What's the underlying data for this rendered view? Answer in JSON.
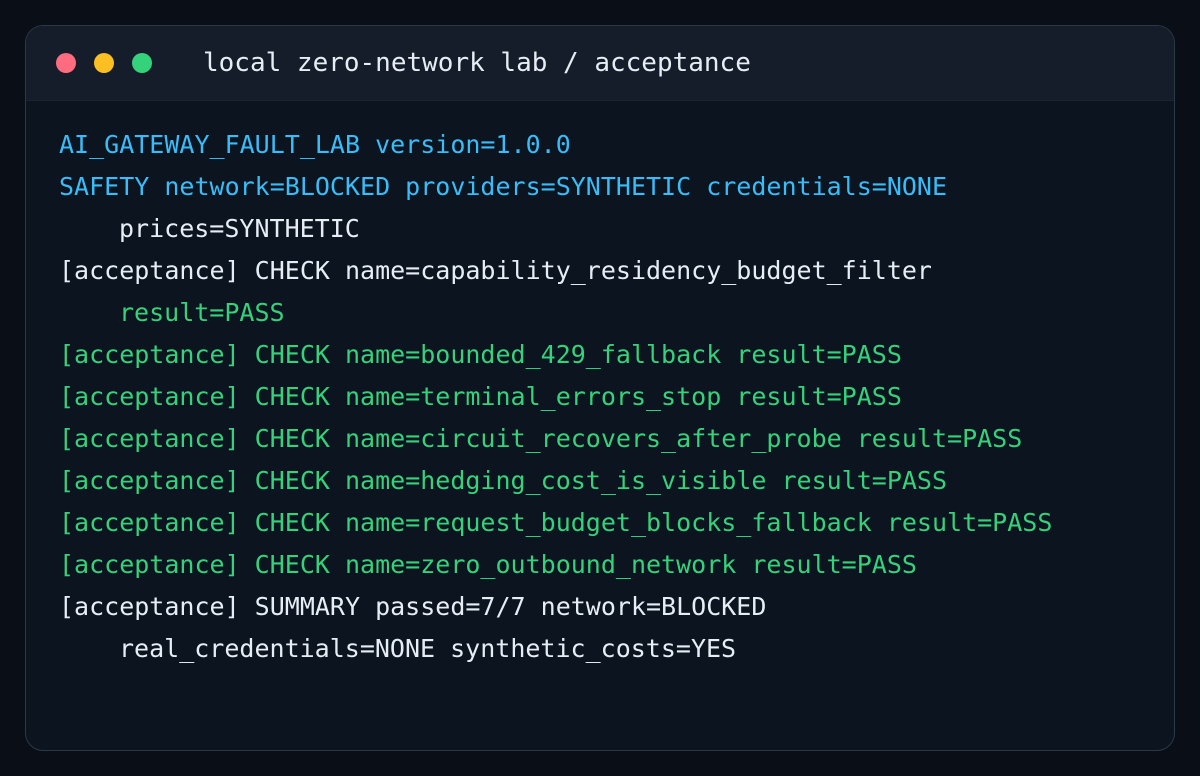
{
  "window": {
    "title": "local zero-network lab / acceptance"
  },
  "colors": {
    "cyan": "#38bdf8",
    "green": "#34d27a",
    "white": "#e6edf5",
    "close": "#ff6b7f",
    "minimize": "#fbbf24",
    "maximize": "#34d27a"
  },
  "terminal": {
    "lines": [
      {
        "text": "AI_GATEWAY_FAULT_LAB version=1.0.0",
        "color": "cyan",
        "indent": false
      },
      {
        "text": "SAFETY network=BLOCKED providers=SYNTHETIC credentials=NONE",
        "color": "cyan",
        "indent": false
      },
      {
        "text": "prices=SYNTHETIC",
        "color": "white",
        "indent": true
      },
      {
        "text": "[acceptance] CHECK name=capability_residency_budget_filter",
        "color": "white",
        "indent": false
      },
      {
        "text": "result=PASS",
        "color": "green",
        "indent": true
      },
      {
        "text": "[acceptance] CHECK name=bounded_429_fallback result=PASS",
        "color": "green",
        "indent": false
      },
      {
        "text": "[acceptance] CHECK name=terminal_errors_stop result=PASS",
        "color": "green",
        "indent": false
      },
      {
        "text": "[acceptance] CHECK name=circuit_recovers_after_probe result=PASS",
        "color": "green",
        "indent": false
      },
      {
        "text": "[acceptance] CHECK name=hedging_cost_is_visible result=PASS",
        "color": "green",
        "indent": false
      },
      {
        "text": "[acceptance] CHECK name=request_budget_blocks_fallback result=PASS",
        "color": "green",
        "indent": false
      },
      {
        "text": "[acceptance] CHECK name=zero_outbound_network result=PASS",
        "color": "green",
        "indent": false
      },
      {
        "text": "[acceptance] SUMMARY passed=7/7 network=BLOCKED",
        "color": "white",
        "indent": false
      },
      {
        "text": "real_credentials=NONE synthetic_costs=YES",
        "color": "white",
        "indent": true
      }
    ]
  }
}
